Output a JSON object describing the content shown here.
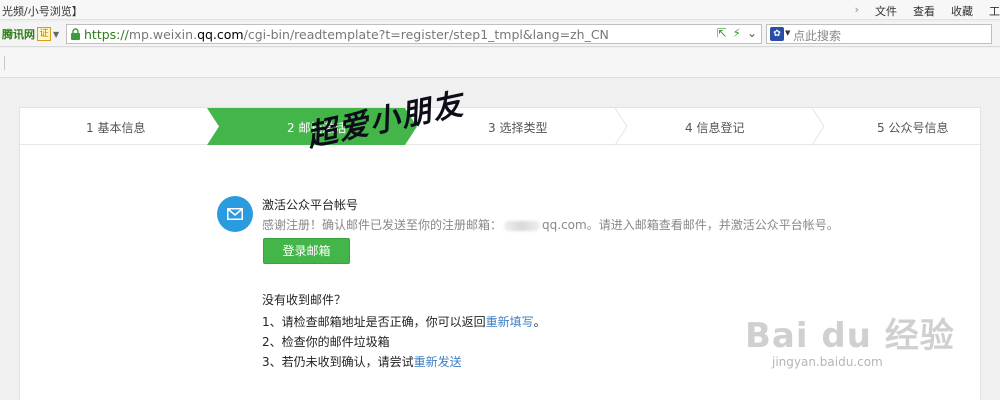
{
  "browser": {
    "window_title": "光频/小号浏览】",
    "menu": [
      "文件",
      "查看",
      "收藏",
      "工"
    ],
    "site_name": "腾讯网",
    "cert_label": "证",
    "url": {
      "protocol": "https://",
      "host_prefix": "mp.weixin.",
      "host_bold": "qq.com",
      "path": "/cgi-bin/readtemplate?t=register/step1_tmpl&lang=zh_CN"
    },
    "search_placeholder": "点此搜索"
  },
  "steps": [
    {
      "label": "1 基本信息",
      "active": false
    },
    {
      "label": "2 邮箱激活",
      "active": true
    },
    {
      "label": "3 选择类型",
      "active": false
    },
    {
      "label": "4 信息登记",
      "active": false
    },
    {
      "label": "5 公众号信息",
      "active": false
    }
  ],
  "message": {
    "title": "激活公众平台帐号",
    "desc_before": "感谢注册！确认邮件已发送至你的注册邮箱：",
    "email_domain": "qq.com",
    "desc_after": "。请进入邮箱查看邮件，并激活公众平台帐号。",
    "login_button": "登录邮箱"
  },
  "help": {
    "title": "没有收到邮件？",
    "tip1_text": "1、请检查邮箱地址是否正确，你可以返回",
    "tip1_link": "重新填写",
    "tip1_end": "。",
    "tip2_text": "2、检查你的邮件垃圾箱",
    "tip3_text": "3、若仍未收到确认，请尝试",
    "tip3_link": "重新发送"
  },
  "overlay": {
    "handwriting": "超爱小朋友",
    "watermark_logo": "Bai du 经验",
    "watermark_url": "jingyan.baidu.com"
  },
  "colors": {
    "accent_green": "#44b549",
    "link_blue": "#3c7ec4",
    "mail_icon_blue": "#2b9be0"
  }
}
